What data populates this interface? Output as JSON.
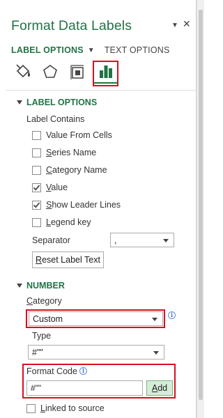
{
  "pane": {
    "title": "Format Data Labels",
    "dropdown_glyph": "▼",
    "close_glyph": "✕"
  },
  "tabs": {
    "label_options": "LABEL OPTIONS",
    "text_options": "TEXT OPTIONS"
  },
  "icon_tabs": [
    {
      "name": "fill-line-icon"
    },
    {
      "name": "effects-icon"
    },
    {
      "name": "size-properties-icon"
    },
    {
      "name": "label-options-icon",
      "selected": true
    }
  ],
  "label_options": {
    "header": "LABEL OPTIONS",
    "contains_label": "Label Contains",
    "checkboxes": [
      {
        "pre": "",
        "u": "",
        "post": "Value From Cells",
        "checked": false
      },
      {
        "pre": "",
        "u": "S",
        "post": "eries Name",
        "checked": false
      },
      {
        "pre": "",
        "u": "C",
        "post": "ategory Name",
        "checked": false
      },
      {
        "pre": "",
        "u": "V",
        "post": "alue",
        "checked": true
      },
      {
        "pre": "",
        "u": "S",
        "post": "how Leader Lines",
        "checked": true
      },
      {
        "pre": "",
        "u": "L",
        "post": "egend key",
        "checked": false
      }
    ],
    "separator_label": "Separator",
    "separator_value": ",",
    "reset_pre": "",
    "reset_u": "R",
    "reset_post": "eset Label Text"
  },
  "number": {
    "header": "NUMBER",
    "category_u": "C",
    "category_post": "ategory",
    "category_value": "Custom",
    "type_label": "Type",
    "type_value": "#\"\"",
    "format_code_label": "Format Code",
    "format_code_value": "#\"\"",
    "add_label_u": "A",
    "add_label_post": "dd",
    "linked_u": "L",
    "linked_post": "inked to source",
    "linked_checked": false
  },
  "info_glyph": "i",
  "colors": {
    "accent": "#217346",
    "highlight": "#d6101f"
  }
}
